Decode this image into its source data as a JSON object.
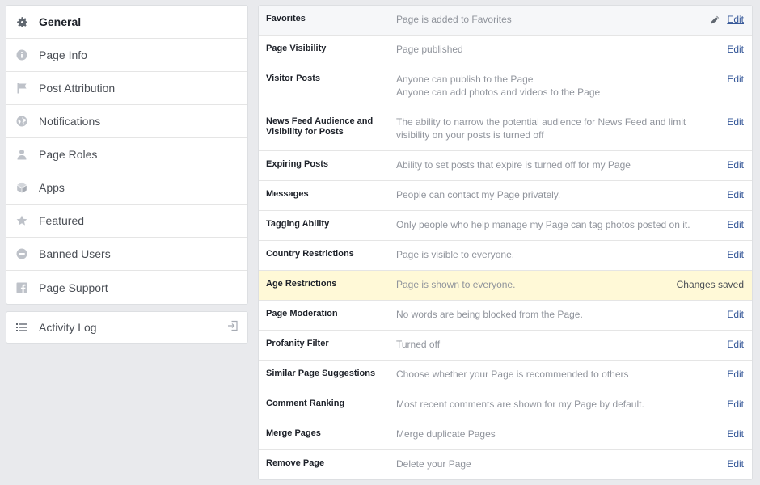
{
  "sidebar": {
    "items": [
      {
        "label": "General",
        "icon": "gear-icon",
        "active": true
      },
      {
        "label": "Page Info",
        "icon": "info-icon"
      },
      {
        "label": "Post Attribution",
        "icon": "flag-icon"
      },
      {
        "label": "Notifications",
        "icon": "globe-icon"
      },
      {
        "label": "Page Roles",
        "icon": "person-icon"
      },
      {
        "label": "Apps",
        "icon": "cube-icon"
      },
      {
        "label": "Featured",
        "icon": "star-icon"
      },
      {
        "label": "Banned Users",
        "icon": "ban-icon"
      },
      {
        "label": "Page Support",
        "icon": "facebook-icon"
      }
    ],
    "activity_log": {
      "label": "Activity Log",
      "icon": "list-icon",
      "action_icon": "exit-icon"
    }
  },
  "settings": {
    "rows": [
      {
        "name": "Favorites",
        "desc": [
          "Page is added to Favorites"
        ],
        "action": "Edit"
      },
      {
        "name": "Page Visibility",
        "desc": [
          "Page published"
        ],
        "action": "Edit"
      },
      {
        "name": "Visitor Posts",
        "desc": [
          "Anyone can publish to the Page",
          "Anyone can add photos and videos to the Page"
        ],
        "action": "Edit"
      },
      {
        "name": "News Feed Audience and Visibility for Posts",
        "desc": [
          "The ability to narrow the potential audience for News Feed and limit visibility on your posts is turned off"
        ],
        "action": "Edit"
      },
      {
        "name": "Expiring Posts",
        "desc": [
          "Ability to set posts that expire is turned off for my Page"
        ],
        "action": "Edit"
      },
      {
        "name": "Messages",
        "desc": [
          "People can contact my Page privately."
        ],
        "action": "Edit"
      },
      {
        "name": "Tagging Ability",
        "desc": [
          "Only people who help manage my Page can tag photos posted on it."
        ],
        "action": "Edit"
      },
      {
        "name": "Country Restrictions",
        "desc": [
          "Page is visible to everyone."
        ],
        "action": "Edit"
      },
      {
        "name": "Age Restrictions",
        "desc": [
          "Page is shown to everyone."
        ],
        "action": "Changes saved"
      },
      {
        "name": "Page Moderation",
        "desc": [
          "No words are being blocked from the Page."
        ],
        "action": "Edit"
      },
      {
        "name": "Profanity Filter",
        "desc": [
          "Turned off"
        ],
        "action": "Edit"
      },
      {
        "name": "Similar Page Suggestions",
        "desc": [
          "Choose whether your Page is recommended to others"
        ],
        "action": "Edit"
      },
      {
        "name": "Comment Ranking",
        "desc": [
          "Most recent comments are shown for my Page by default."
        ],
        "action": "Edit"
      },
      {
        "name": "Merge Pages",
        "desc": [
          "Merge duplicate Pages"
        ],
        "action": "Edit"
      },
      {
        "name": "Remove Page",
        "desc": [
          "Delete your Page"
        ],
        "action": "Edit"
      }
    ]
  },
  "colors": {
    "background": "#e9eaed",
    "link": "#365899",
    "highlight": "#fff9d7",
    "muted_text": "#90949c"
  }
}
